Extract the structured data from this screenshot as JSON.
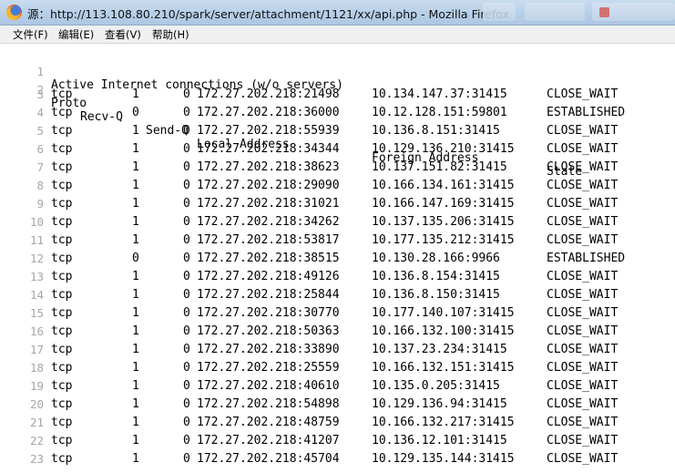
{
  "window": {
    "title": "源：http://113.108.80.210/spark/server/attachment/1121/xx/api.php - Mozilla Firefox"
  },
  "menu": [
    "文件(F)",
    "编辑(E)",
    "查看(V)",
    "帮助(H)"
  ],
  "source": {
    "header_line": "Active Internet connections (w/o servers)",
    "columns": [
      "Proto",
      "Recv-Q",
      "Send-Q",
      "Local Address",
      "Foreign Address",
      "State"
    ],
    "rows": [
      [
        "tcp",
        "1",
        "0",
        "172.27.202.218:21498",
        "10.134.147.37:31415",
        "CLOSE_WAIT"
      ],
      [
        "tcp",
        "0",
        "0",
        "172.27.202.218:36000",
        "10.12.128.151:59801",
        "ESTABLISHED"
      ],
      [
        "tcp",
        "1",
        "0",
        "172.27.202.218:55939",
        "10.136.8.151:31415",
        "CLOSE_WAIT"
      ],
      [
        "tcp",
        "1",
        "0",
        "172.27.202.218:34344",
        "10.129.136.210:31415",
        "CLOSE_WAIT"
      ],
      [
        "tcp",
        "1",
        "0",
        "172.27.202.218:38623",
        "10.137.151.82:31415",
        "CLOSE_WAIT"
      ],
      [
        "tcp",
        "1",
        "0",
        "172.27.202.218:29090",
        "10.166.134.161:31415",
        "CLOSE_WAIT"
      ],
      [
        "tcp",
        "1",
        "0",
        "172.27.202.218:31021",
        "10.166.147.169:31415",
        "CLOSE_WAIT"
      ],
      [
        "tcp",
        "1",
        "0",
        "172.27.202.218:34262",
        "10.137.135.206:31415",
        "CLOSE_WAIT"
      ],
      [
        "tcp",
        "1",
        "0",
        "172.27.202.218:53817",
        "10.177.135.212:31415",
        "CLOSE_WAIT"
      ],
      [
        "tcp",
        "0",
        "0",
        "172.27.202.218:38515",
        "10.130.28.166:9966",
        "ESTABLISHED"
      ],
      [
        "tcp",
        "1",
        "0",
        "172.27.202.218:49126",
        "10.136.8.154:31415",
        "CLOSE_WAIT"
      ],
      [
        "tcp",
        "1",
        "0",
        "172.27.202.218:25844",
        "10.136.8.150:31415",
        "CLOSE_WAIT"
      ],
      [
        "tcp",
        "1",
        "0",
        "172.27.202.218:30770",
        "10.177.140.107:31415",
        "CLOSE_WAIT"
      ],
      [
        "tcp",
        "1",
        "0",
        "172.27.202.218:50363",
        "10.166.132.100:31415",
        "CLOSE_WAIT"
      ],
      [
        "tcp",
        "1",
        "0",
        "172.27.202.218:33890",
        "10.137.23.234:31415",
        "CLOSE_WAIT"
      ],
      [
        "tcp",
        "1",
        "0",
        "172.27.202.218:25559",
        "10.166.132.151:31415",
        "CLOSE_WAIT"
      ],
      [
        "tcp",
        "1",
        "0",
        "172.27.202.218:40610",
        "10.135.0.205:31415",
        "CLOSE_WAIT"
      ],
      [
        "tcp",
        "1",
        "0",
        "172.27.202.218:54898",
        "10.129.136.94:31415",
        "CLOSE_WAIT"
      ],
      [
        "tcp",
        "1",
        "0",
        "172.27.202.218:48759",
        "10.166.132.217:31415",
        "CLOSE_WAIT"
      ],
      [
        "tcp",
        "1",
        "0",
        "172.27.202.218:41207",
        "10.136.12.101:31415",
        "CLOSE_WAIT"
      ],
      [
        "tcp",
        "1",
        "0",
        "172.27.202.218:45704",
        "10.129.135.144:31415",
        "CLOSE_WAIT"
      ]
    ]
  }
}
